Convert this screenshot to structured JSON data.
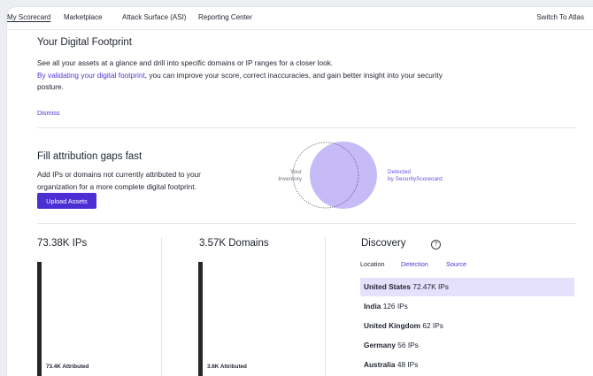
{
  "nav": {
    "tabs": [
      {
        "label": "My Scorecard"
      },
      {
        "label": "Marketplace"
      },
      {
        "label": "Attack Surface (ASI)"
      },
      {
        "label": "Reporting Center"
      }
    ],
    "switch_label": "Switch To Atlas"
  },
  "footprint": {
    "title": "Your Digital Footprint",
    "line1": "See all your assets at a glance and drill into specific domains or IP ranges for a closer look.",
    "link": "By validating your digital footprint",
    "rest": ", you can improve your score, correct inaccuracies, and gain better insight into your security posture.",
    "dismiss": "Dismiss"
  },
  "attribution": {
    "title": "Fill attribution gaps fast",
    "text": "Add IPs or domains not currently attributed to your organization for a more complete digital footprint.",
    "button": "Upload Assets",
    "venn_left_1": "Your",
    "venn_left_2": "Inventory",
    "venn_right_1": "Detected",
    "venn_right_2": "by SecurityScorecard"
  },
  "stats": {
    "ips_title": "73.38K IPs",
    "ips_bar_label": "73.4K Attributed",
    "domains_title": "3.57K Domains",
    "domains_bar_label": "3.6K Attributed"
  },
  "discovery": {
    "title": "Discovery",
    "help_icon": "?",
    "tabs": [
      {
        "label": "Location"
      },
      {
        "label": "Detection"
      },
      {
        "label": "Source"
      }
    ],
    "rows": [
      {
        "name": "United States",
        "value": "72.47K IPs"
      },
      {
        "name": "India",
        "value": "126 IPs"
      },
      {
        "name": "United Kingdom",
        "value": "62 IPs"
      },
      {
        "name": "Germany",
        "value": "56 IPs"
      },
      {
        "name": "Australia",
        "value": "48 IPs"
      }
    ]
  },
  "colors": {
    "accent": "#4b2fd5",
    "venn_fill": "#c7bbf7",
    "selected_row": "#e5e0fb"
  }
}
